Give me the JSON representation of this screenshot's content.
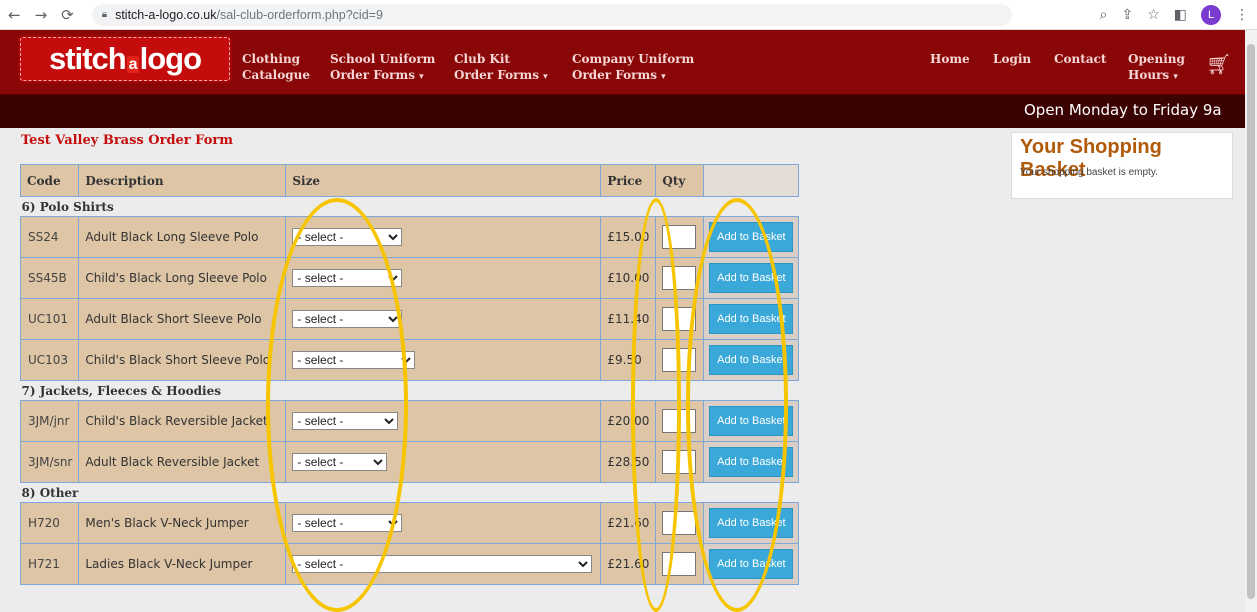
{
  "browser": {
    "host": "stitch-a-logo.co.uk",
    "path": "/sal-club-orderform.php?cid=9",
    "profile_initial": "L"
  },
  "header": {
    "logo_part1": "stitch",
    "logo_part2": "a",
    "logo_part3": "logo",
    "menu": [
      {
        "line1": "Clothing",
        "line2": "Catalogue"
      },
      {
        "line1": "School Uniform",
        "line2": "Order Forms"
      },
      {
        "line1": "Club Kit",
        "line2": "Order Forms"
      },
      {
        "line1": "Company Uniform",
        "line2": "Order Forms"
      },
      {
        "line1": "Home"
      },
      {
        "line1": "Login"
      },
      {
        "line1": "Contact"
      },
      {
        "line1": "Opening",
        "line2": "Hours"
      }
    ],
    "caret": "▾"
  },
  "ticker": {
    "text": "Open Monday to Friday 9a"
  },
  "form": {
    "title": "Test Valley Brass Order Form",
    "columns": [
      "Code",
      "Description",
      "Size",
      "Price",
      "Qty",
      ""
    ],
    "select_placeholder": "- select -",
    "button_label": "Add to Basket",
    "groups": [
      {
        "name": "6) Polo Shirts",
        "items": [
          {
            "code": "SS24",
            "description": "Adult Black Long Sleeve Polo",
            "price": "£15.00"
          },
          {
            "code": "SS45B",
            "description": "Child's Black Long Sleeve Polo",
            "price": "£10.00"
          },
          {
            "code": "UC101",
            "description": "Adult Black Short Sleeve Polo",
            "price": "£11.40"
          },
          {
            "code": "UC103",
            "description": "Child's Black Short Sleeve Polo",
            "price": "£9.50"
          }
        ]
      },
      {
        "name": "7) Jackets, Fleeces & Hoodies",
        "items": [
          {
            "code": "3JM/jnr",
            "description": "Child's Black Reversible Jacket",
            "price": "£20.00"
          },
          {
            "code": "3JM/snr",
            "description": "Adult Black Reversible Jacket",
            "price": "£28.50"
          }
        ]
      },
      {
        "name": "8) Other",
        "items": [
          {
            "code": "H720",
            "description": "Men's Black V-Neck Jumper",
            "price": "£21.60"
          },
          {
            "code": "H721",
            "description": "Ladies Black V-Neck Jumper",
            "price": "£21.60"
          }
        ]
      }
    ]
  },
  "basket": {
    "title": "Your Shopping Basket",
    "message": "Your shopping basket is empty."
  },
  "colors": {
    "highlight": "#f7c500",
    "brand": "#8a0707"
  }
}
